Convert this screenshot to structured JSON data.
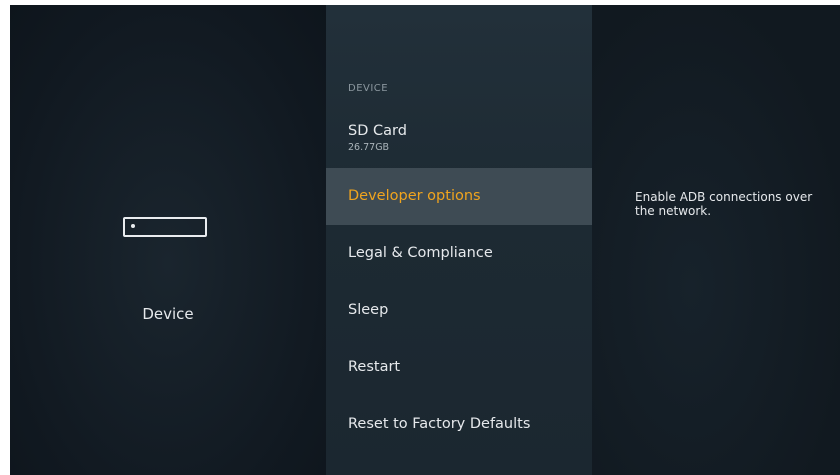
{
  "left_pane": {
    "icon": "fire-tv-device-icon",
    "label": "Device"
  },
  "menu": {
    "section_header": "DEVICE",
    "items": [
      {
        "label": "SD Card",
        "sublabel": "26.77GB",
        "selected": false
      },
      {
        "label": "Developer options",
        "selected": true
      },
      {
        "label": "Legal & Compliance",
        "selected": false
      },
      {
        "label": "Sleep",
        "selected": false
      },
      {
        "label": "Restart",
        "selected": false
      },
      {
        "label": "Reset to Factory Defaults",
        "selected": false
      }
    ]
  },
  "description": {
    "text": "Enable ADB connections over the network."
  },
  "colors": {
    "selected_text": "#f0a41e",
    "selected_background": "#3e4b54",
    "background": "#131c24"
  }
}
